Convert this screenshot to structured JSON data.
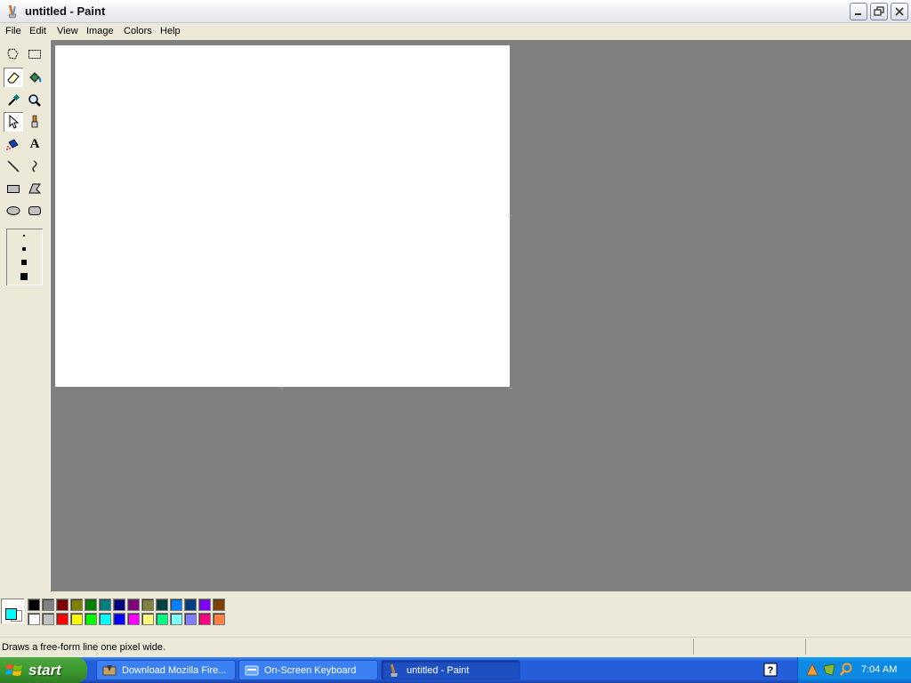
{
  "window": {
    "title": "untitled - Paint"
  },
  "menu": [
    "File",
    "Edit",
    "View",
    "Image",
    "Colors",
    "Help"
  ],
  "tools": [
    {
      "name": "free-form-select"
    },
    {
      "name": "select"
    },
    {
      "name": "eraser"
    },
    {
      "name": "fill-with-color"
    },
    {
      "name": "pick-color"
    },
    {
      "name": "magnifier"
    },
    {
      "name": "pencil"
    },
    {
      "name": "brush"
    },
    {
      "name": "airbrush"
    },
    {
      "name": "text"
    },
    {
      "name": "line"
    },
    {
      "name": "curve"
    },
    {
      "name": "rectangle"
    },
    {
      "name": "polygon"
    },
    {
      "name": "ellipse"
    },
    {
      "name": "rounded-rectangle"
    }
  ],
  "text_tool_glyph": "A",
  "colors": {
    "foreground": "#00ffff",
    "background": "#ffffff",
    "palette_top": [
      "#000000",
      "#808080",
      "#800000",
      "#808000",
      "#008000",
      "#008080",
      "#000080",
      "#800080",
      "#808040",
      "#004040",
      "#0080ff",
      "#004080",
      "#8000ff",
      "#804000"
    ],
    "palette_bottom": [
      "#ffffff",
      "#c0c0c0",
      "#ff0000",
      "#ffff00",
      "#00ff00",
      "#00ffff",
      "#0000ff",
      "#ff00ff",
      "#ffff80",
      "#00ff80",
      "#80ffff",
      "#8080ff",
      "#ff0080",
      "#ff8040"
    ]
  },
  "status": {
    "text": "Draws a free-form line one pixel wide."
  },
  "taskbar": {
    "start_label": "start",
    "items": [
      {
        "label": "Download Mozilla Fire...",
        "active": false
      },
      {
        "label": "On-Screen Keyboard",
        "active": false
      },
      {
        "label": "untitled - Paint",
        "active": true
      }
    ],
    "clock": "7:04 AM"
  }
}
